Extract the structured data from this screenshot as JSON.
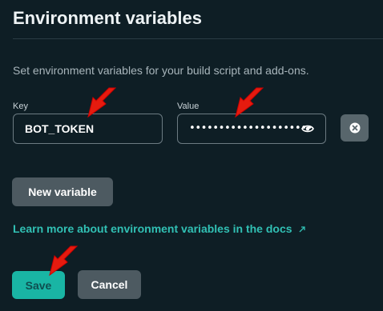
{
  "header": {
    "title": "Environment variables"
  },
  "description": "Set environment variables for your build script and add-ons.",
  "form": {
    "key_label": "Key",
    "key_value": "BOT_TOKEN",
    "value_label": "Value",
    "value_masked": "•••••••••••••••••••••"
  },
  "actions": {
    "new_variable": "New variable",
    "docs_link": "Learn more about environment variables in the docs",
    "save": "Save",
    "cancel": "Cancel"
  },
  "icons": {
    "reveal": "eye-icon",
    "remove": "close-circle-icon",
    "external": "external-link-icon",
    "annotation": "red-arrow-icon"
  },
  "colors": {
    "background": "#0e1e25",
    "accent": "#19b5a4",
    "link": "#31c0b4",
    "annotation": "#e51b0f"
  }
}
